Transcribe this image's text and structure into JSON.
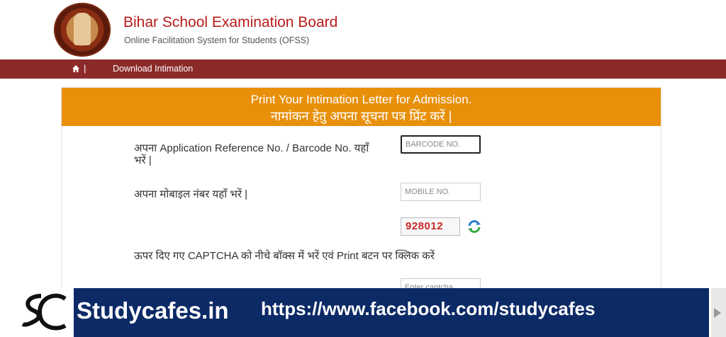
{
  "header": {
    "title": "Bihar School Examination Board",
    "subtitle": "Online Facilitation System for Students (OFSS)"
  },
  "nav": {
    "home_icon": "home-icon",
    "separator": "|",
    "link": "Download Intimation"
  },
  "panel": {
    "heading_en": "Print Your Intimation Letter for Admission.",
    "heading_hi": "नामांकन हेतु अपना सूचना पत्र प्रिंट करें |",
    "accent_color": "#e8900a"
  },
  "form": {
    "barcode_label": "अपना Application Reference No. / Barcode No. यहाँ भरें |",
    "barcode_placeholder": "BARCODE NO.",
    "mobile_label": "अपना मोबाइल नंबर यहाँ भरें |",
    "mobile_placeholder": "MOBILE NO.",
    "captcha_value": "928012",
    "captcha_instruction": "ऊपर दिए गए CAPTCHA को नीचे बॉक्स में भरें एवं Print बटन पर क्लिक करें",
    "captcha_placeholder": "Enter captcha"
  },
  "banner": {
    "site": "Studycafes.in",
    "url": "https://www.facebook.com/studycafes",
    "bar_color": "#0c2a66"
  }
}
